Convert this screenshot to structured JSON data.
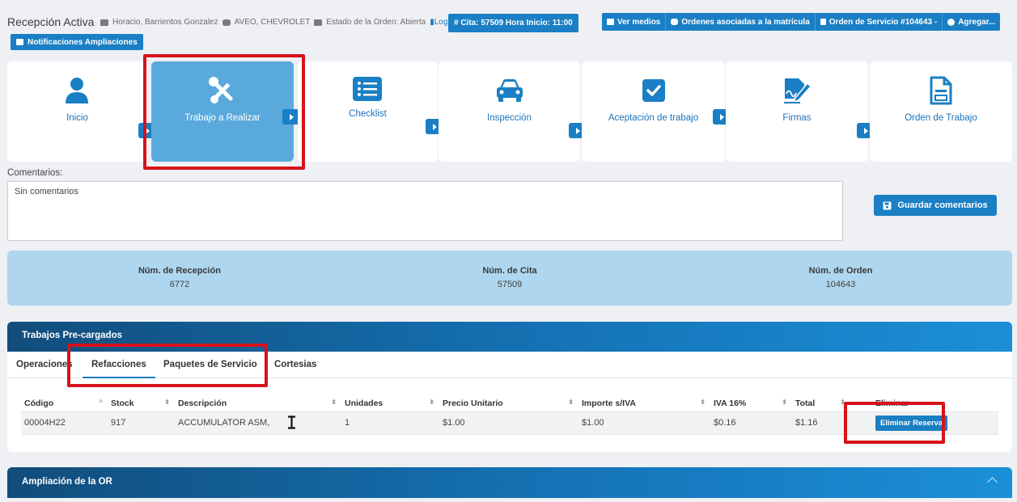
{
  "header": {
    "title": "Recepción Activa",
    "client": "Horacio, Barrientos Gonzalez",
    "vehicle": "AVEO, CHEVROLET",
    "order_status": "Estado de la Orden: Abierta",
    "log_label": "Log",
    "cita_label": "# Cita: 57509 Hora Inicio: 11:00",
    "buttons": {
      "ver_medios": "Ver medios",
      "ordenes_asociadas": "Ordenes asociadas a la matrícula",
      "orden_servicio": "Orden de Servicio #104643 -",
      "agregar": "Agregar..."
    },
    "notificaciones": "Notificaciones Ampliaciones"
  },
  "steps": [
    {
      "label": "Inicio",
      "icon": "user-icon"
    },
    {
      "label": "Trabajo a Realizar",
      "icon": "tools-icon"
    },
    {
      "label": "Checklist",
      "icon": "list-icon"
    },
    {
      "label": "Inspección",
      "icon": "car-icon"
    },
    {
      "label": "Aceptación de trabajo",
      "icon": "check-square-icon"
    },
    {
      "label": "Firmas",
      "icon": "signature-icon"
    },
    {
      "label": "Orden de Trabajo",
      "icon": "document-icon"
    }
  ],
  "comments": {
    "label": "Comentarios:",
    "value": "Sin comentarios",
    "save_label": "Guardar comentarios"
  },
  "numbers": [
    {
      "title": "Núm. de Recepción",
      "value": "6772"
    },
    {
      "title": "Núm. de Cita",
      "value": "57509"
    },
    {
      "title": "Núm. de Orden",
      "value": "104643"
    }
  ],
  "trabajos": {
    "title": "Trabajos Pre-cargados",
    "tabs": [
      "Operaciones",
      "Refacciones",
      "Paquetes de Servicio",
      "Cortesias"
    ],
    "columns": [
      "Código",
      "Stock",
      "Descripción",
      "Unidades",
      "Precio Unitario",
      "Importe s/IVA",
      "IVA 16%",
      "Total",
      "Eliminar"
    ],
    "rows": [
      {
        "codigo": "00004H22",
        "stock": "917",
        "descripcion": "ACCUMULATOR ASM,",
        "unidades": "1",
        "precio": "$1.00",
        "importe": "$1.00",
        "iva": "$0.16",
        "total": "$1.16",
        "action": "Eliminar Reserva"
      }
    ]
  },
  "ampliacion": {
    "title": "Ampliación de la OR"
  },
  "colors": {
    "accent": "#1a7fc4",
    "active_step": "#5aa9dc",
    "highlight": "#d6121a"
  }
}
